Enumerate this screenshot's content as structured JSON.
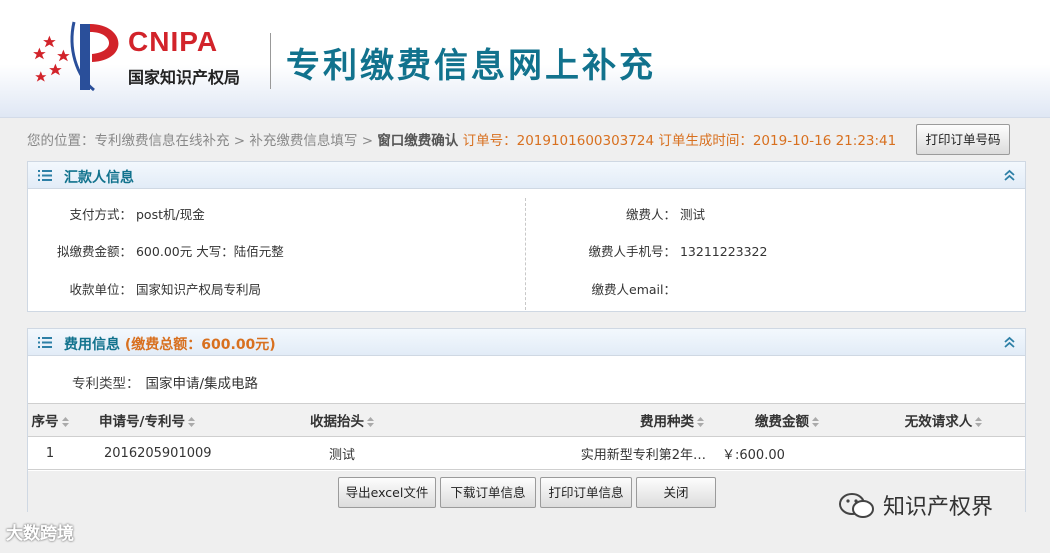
{
  "header": {
    "logo_text": "CNIPA",
    "logo_sub": "国家知识产权局",
    "site_title": "专利缴费信息网上补充"
  },
  "breadcrumb": {
    "prefix": "您的位置：",
    "item1": "专利缴费信息在线补充",
    "sep": ">",
    "item2": "补充缴费信息填写",
    "current": "窗口缴费确认",
    "order_label": "订单号：",
    "order_no": "2019101600303724",
    "time_label": "订单生成时间：",
    "time": "2019-10-16 21:23:41",
    "print_order_btn": "打印订单号码"
  },
  "payer_panel": {
    "title": "汇款人信息",
    "left": [
      {
        "label": "支付方式：",
        "value": "post机/现金"
      },
      {
        "label": "拟缴费金额：",
        "value": "600.00元  大写：陆佰元整"
      },
      {
        "label": "收款单位：",
        "value": "国家知识产权局专利局"
      }
    ],
    "right": [
      {
        "label": "缴费人：",
        "value": "测试"
      },
      {
        "label": "缴费人手机号：",
        "value": "13211223322"
      },
      {
        "label": "缴费人email：",
        "value": ""
      }
    ]
  },
  "fee_panel": {
    "title": "费用信息",
    "total": "(缴费总额：600.00元)",
    "patent_type_label": "专利类型：",
    "patent_type_value": "国家申请/集成电路",
    "columns": [
      "序号",
      "申请号/专利号",
      "收据抬头",
      "费用种类",
      "缴费金额",
      "无效请求人"
    ],
    "rows": [
      [
        "1",
        "2016205901009",
        "测试",
        "实用新型专利第2年…",
        "￥:600.00",
        ""
      ]
    ],
    "buttons": {
      "export": "导出excel文件",
      "download": "下载订单信息",
      "print": "打印订单信息",
      "close": "关闭"
    }
  },
  "watermarks": {
    "right": "知识产权界",
    "left": "大数跨境"
  },
  "colors": {
    "title_teal": "#11728d",
    "order_orange": "#d8701f",
    "logo_red": "#d2232a"
  }
}
